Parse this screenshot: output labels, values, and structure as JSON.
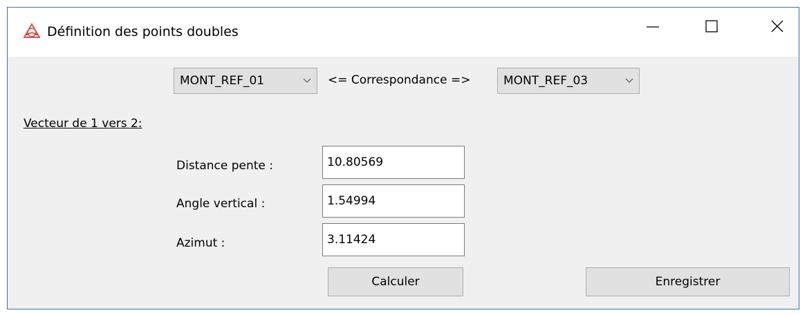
{
  "window": {
    "title": "Définition des points doubles"
  },
  "selection": {
    "point1": "MONT_REF_01",
    "point2": "MONT_REF_03",
    "correspondance_label": "<= Correspondance =>"
  },
  "section": {
    "label": "Vecteur de 1 vers 2:"
  },
  "fields": {
    "distance_label": "Distance pente :",
    "distance_value": "10.80569",
    "angle_label": "Angle vertical :",
    "angle_value": "1.54994",
    "azimut_label": "Azimut :",
    "azimut_value": "3.11424"
  },
  "buttons": {
    "calculer": "Calculer",
    "enregistrer": "Enregistrer"
  },
  "icons": {
    "app": "app-logo-icon",
    "minimize": "minimize-icon",
    "maximize": "maximize-icon",
    "close": "close-icon",
    "dropdown": "chevron-down-icon"
  },
  "colors": {
    "window_border": "#2a6fc9",
    "client_background": "#f0f0f0",
    "button_face": "#e1e1e1",
    "app_icon": "#d9534f"
  }
}
